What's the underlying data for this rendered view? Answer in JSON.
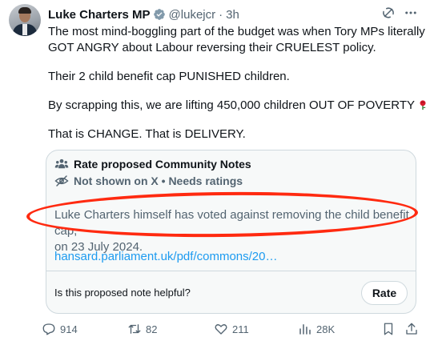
{
  "tweet": {
    "author_name": "Luke Charters MP",
    "handle": "@lukejcr",
    "separator": "·",
    "time": "3h",
    "paragraphs": [
      "The most mind-boggling part of the budget was when Tory MPs literally",
      "GOT ANGRY about Labour reversing their CRUELEST policy.",
      "Their 2 child benefit cap PUNISHED children.",
      "By scrapping this, we are lifting 450,000 children OUT OF POVERTY",
      "That is CHANGE. That is DELIVERY."
    ]
  },
  "community_note": {
    "title": "Rate proposed Community Notes",
    "status": "Not shown on X • Needs ratings",
    "text_line1": "Luke Charters himself has voted against removing the child benefit cap,",
    "text_line2": "on 23 July 2024.",
    "link": "hansard.parliament.uk/pdf/commons/20…",
    "question": "Is this proposed note helpful?",
    "rate_label": "Rate"
  },
  "actions": {
    "replies": "914",
    "reposts": "82",
    "likes": "211",
    "views": "28K"
  },
  "colors": {
    "accent": "#1d9bf0",
    "annotation": "#ff2a10",
    "muted": "#536471"
  }
}
